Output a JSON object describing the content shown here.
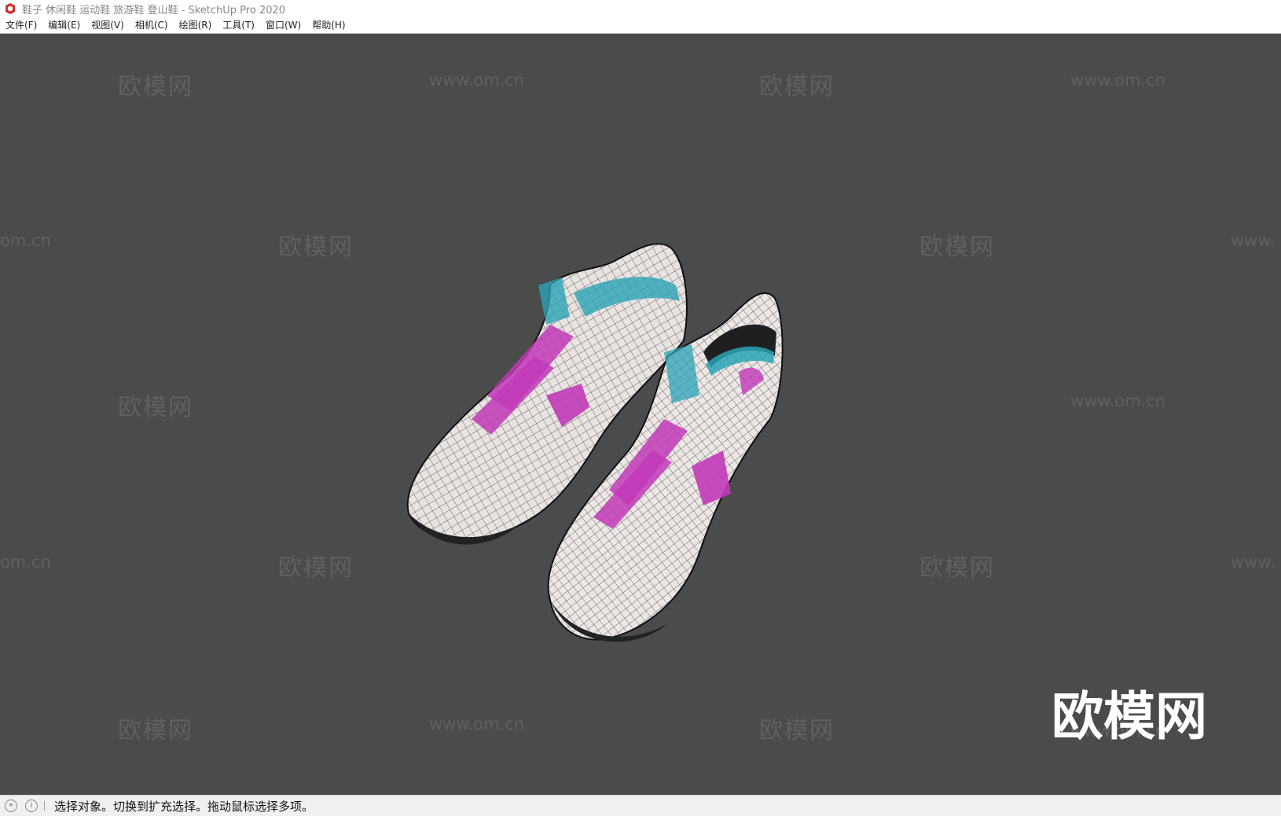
{
  "window": {
    "title": "鞋子 休闲鞋 运动鞋 旅游鞋 登山鞋 - SketchUp Pro 2020",
    "icon": "sketchup-icon"
  },
  "menu": {
    "items": [
      {
        "label": "文件(F)"
      },
      {
        "label": "编辑(E)"
      },
      {
        "label": "视图(V)"
      },
      {
        "label": "相机(C)"
      },
      {
        "label": "绘图(R)"
      },
      {
        "label": "工具(T)"
      },
      {
        "label": "窗口(W)"
      },
      {
        "label": "帮助(H)"
      }
    ]
  },
  "watermark": {
    "cn": "欧模网",
    "url": "www.om.cn",
    "url_partial_left": "om.cn",
    "url_partial_right": "www."
  },
  "logo": {
    "text": "欧模网",
    "url": "www.om.cn"
  },
  "status": {
    "message": "选择对象。切换到扩充选择。拖动鼠标选择多项。",
    "icons": [
      "geo-location-icon",
      "info-icon"
    ]
  },
  "colors": {
    "viewport_bg": "#4b4b4b",
    "shoe_base": "#e9e4e2",
    "accent_magenta": "#c23ab8",
    "accent_teal": "#2aa3b5"
  }
}
